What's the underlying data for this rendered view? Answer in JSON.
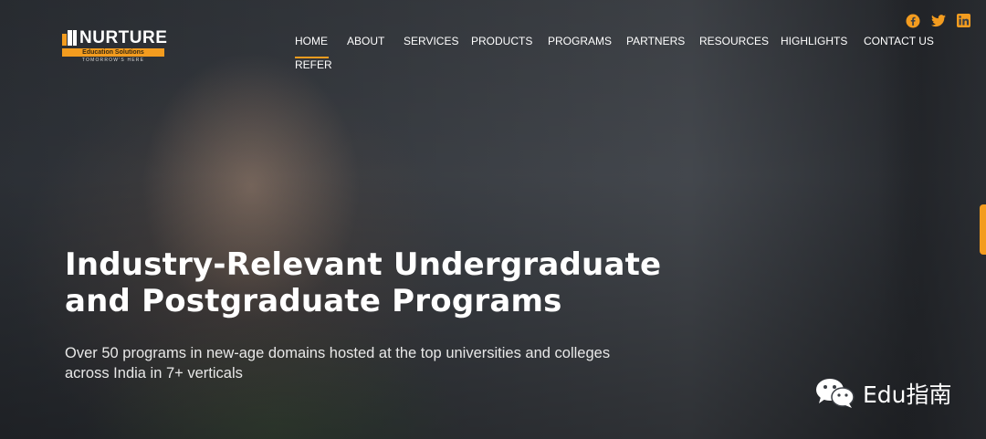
{
  "brand": {
    "name": "NURTURE",
    "subtitle": "Education Solutions",
    "tagline": "TOMORROW'S HERE",
    "accent": "#f39c1f"
  },
  "nav": {
    "items": [
      {
        "label": "HOME",
        "active": true
      },
      {
        "label": "ABOUT"
      },
      {
        "label": "SERVICES"
      },
      {
        "label": "PRODUCTS"
      },
      {
        "label": "PROGRAMS"
      },
      {
        "label": "PARTNERS"
      },
      {
        "label": "RESOURCES"
      },
      {
        "label": "HIGHLIGHTS"
      },
      {
        "label": "CONTACT US"
      },
      {
        "label": "REFER"
      }
    ]
  },
  "social": {
    "icons": [
      "facebook-icon",
      "twitter-icon",
      "linkedin-icon"
    ],
    "color": "#f39c1f"
  },
  "hero": {
    "title_line1": "Industry-Relevant Undergraduate",
    "title_line2": "and Postgraduate Programs",
    "desc_line1": "Over 50 programs in new-age domains hosted at the top universities and colleges",
    "desc_line2": "across India in 7+ verticals"
  },
  "watermark": {
    "text": "Edu指南",
    "icon": "wechat-icon"
  }
}
